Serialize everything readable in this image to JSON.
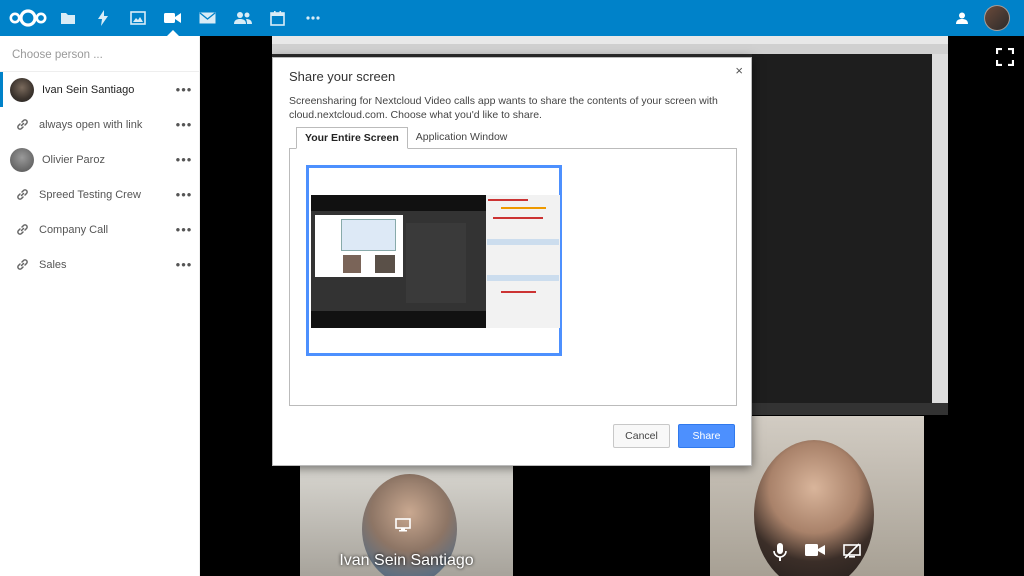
{
  "header": {
    "nav_icons": [
      "files-icon",
      "activity-icon",
      "gallery-icon",
      "video-call-icon",
      "mail-icon",
      "contacts-icon",
      "calendar-icon",
      "more-apps-icon"
    ],
    "accent": "#0082c9"
  },
  "sidebar": {
    "search_placeholder": "Choose person ...",
    "items": [
      {
        "label": "Ivan Sein Santiago",
        "kind": "avatar",
        "more": "•••"
      },
      {
        "label": "always open with link",
        "kind": "link",
        "more": "•••"
      },
      {
        "label": "Olivier Paroz",
        "kind": "avatar",
        "more": "•••"
      },
      {
        "label": "Spreed Testing Crew",
        "kind": "link",
        "more": "•••"
      },
      {
        "label": "Company Call",
        "kind": "link",
        "more": "•••"
      },
      {
        "label": "Sales",
        "kind": "link",
        "more": "•••"
      }
    ]
  },
  "dialog": {
    "title": "Share your screen",
    "close": "×",
    "description": "Screensharing for Nextcloud Video calls app wants to share the contents of your screen with cloud.nextcloud.com. Choose what you'd like to share.",
    "tabs": [
      {
        "label": "Your Entire Screen",
        "active": true
      },
      {
        "label": "Application Window",
        "active": false
      }
    ],
    "cancel_label": "Cancel",
    "share_label": "Share",
    "share_color": "#4d90fe"
  },
  "videos": {
    "left_name": "Ivan Sein Santiago"
  }
}
